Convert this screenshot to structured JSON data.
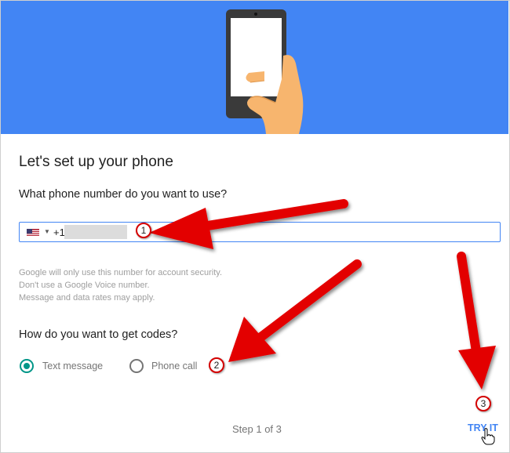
{
  "page": {
    "title": "Let's set up your phone",
    "question_number": "What phone number do you want to use?",
    "question_codes": "How do you want to get codes?"
  },
  "phone_input": {
    "country_flag": "us-flag-icon",
    "country_code": "+1",
    "value": "masked"
  },
  "help_text": [
    "Google will only use this number for account security.",
    "Don't use a Google Voice number.",
    "Message and data rates may apply."
  ],
  "code_options": [
    {
      "label": "Text message",
      "selected": true
    },
    {
      "label": "Phone call",
      "selected": false
    }
  ],
  "footer": {
    "step": "Step 1 of 3",
    "try_it": "TRY IT"
  },
  "annotations": [
    "1",
    "2",
    "3"
  ],
  "colors": {
    "hero_blue": "#4285f4",
    "accent_teal": "#009688",
    "link_blue": "#4285f4",
    "arrow_red": "#e30000"
  }
}
